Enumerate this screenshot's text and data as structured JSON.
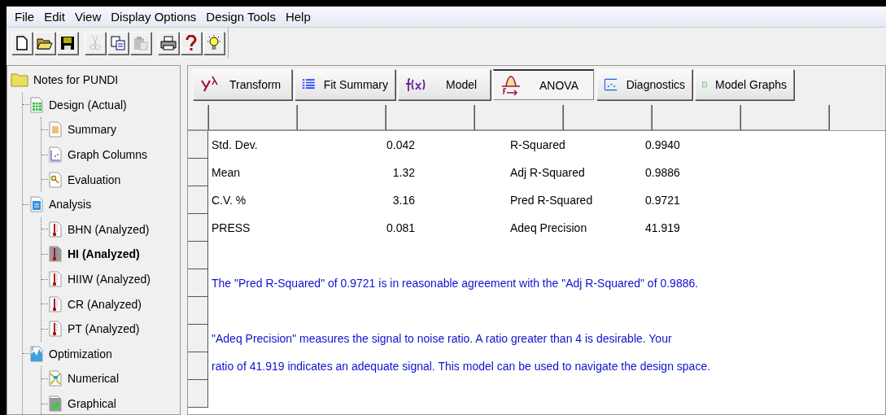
{
  "menu": [
    "File",
    "Edit",
    "View",
    "Display Options",
    "Design Tools",
    "Help"
  ],
  "toolbar": [
    [
      {
        "kind": "new",
        "disabled": false
      },
      {
        "kind": "open",
        "disabled": false
      },
      {
        "kind": "save",
        "disabled": false
      }
    ],
    [
      {
        "kind": "cut",
        "disabled": true
      },
      {
        "kind": "copy",
        "disabled": false
      },
      {
        "kind": "paste",
        "disabled": true
      }
    ],
    [
      {
        "kind": "print",
        "disabled": false
      },
      {
        "kind": "help",
        "disabled": false
      },
      {
        "kind": "tip",
        "disabled": false
      }
    ]
  ],
  "tree": {
    "label": "Notes for PUNDI",
    "kind": "folder",
    "selected": false,
    "children": [
      {
        "label": "Design (Actual)",
        "kind": "grid",
        "selected": false,
        "children": [
          {
            "label": "Summary",
            "kind": "sheet",
            "selected": false
          },
          {
            "label": "Graph Columns",
            "kind": "graph",
            "selected": false
          },
          {
            "label": "Evaluation",
            "kind": "search",
            "selected": false
          }
        ]
      },
      {
        "label": "Analysis",
        "kind": "calc",
        "selected": false,
        "children": [
          {
            "label": "BHN (Analyzed)",
            "kind": "thermo",
            "selected": false
          },
          {
            "label": "HI (Analyzed)",
            "kind": "thermo",
            "selected": true
          },
          {
            "label": "HIIW (Analyzed)",
            "kind": "thermo",
            "selected": false
          },
          {
            "label": "CR (Analyzed)",
            "kind": "thermo",
            "selected": false
          },
          {
            "label": "PT (Analyzed)",
            "kind": "thermo",
            "selected": false
          }
        ]
      },
      {
        "label": "Optimization",
        "kind": "optimize",
        "selected": false,
        "children": [
          {
            "label": "Numerical",
            "kind": "numerical",
            "selected": false
          },
          {
            "label": "Graphical",
            "kind": "graphical",
            "selected": false
          }
        ]
      }
    ]
  },
  "tabs": [
    {
      "label": "Transform",
      "kind": "transform",
      "selected": false
    },
    {
      "label": "Fit Summary",
      "kind": "fit",
      "selected": false
    },
    {
      "label": "Model",
      "kind": "model",
      "selected": false
    },
    {
      "label": "ANOVA",
      "kind": "anova",
      "selected": true
    },
    {
      "label": "Diagnostics",
      "kind": "diagnostics",
      "selected": false
    },
    {
      "label": "Model Graphs",
      "kind": "graphs",
      "selected": false
    }
  ],
  "stats": [
    {
      "label": "Std. Dev.",
      "value": "0.042",
      "label_2": "R-Squared",
      "value_2": "0.9940"
    },
    {
      "label": "Mean",
      "value": "1.32",
      "label_2": "Adj R-Squared",
      "value_2": "0.9886"
    },
    {
      "label": "C.V. %",
      "value": "3.16",
      "label_2": "Pred R-Squared",
      "value_2": "0.9721"
    },
    {
      "label": "PRESS",
      "value": "0.081",
      "label_2": "Adeq Precision",
      "value_2": "41.919"
    }
  ],
  "notes": [
    [
      "The \"Pred R-Squared\" of 0.9721 is in reasonable agreement with the \"Adj R-Squared\" of 0.9886."
    ],
    [
      "\"Adeq Precision\" measures the signal to noise ratio.  A ratio greater than 4 is desirable.  Your",
      "ratio of 41.919 indicates an adequate signal.  This model can be used to navigate the design space."
    ]
  ]
}
